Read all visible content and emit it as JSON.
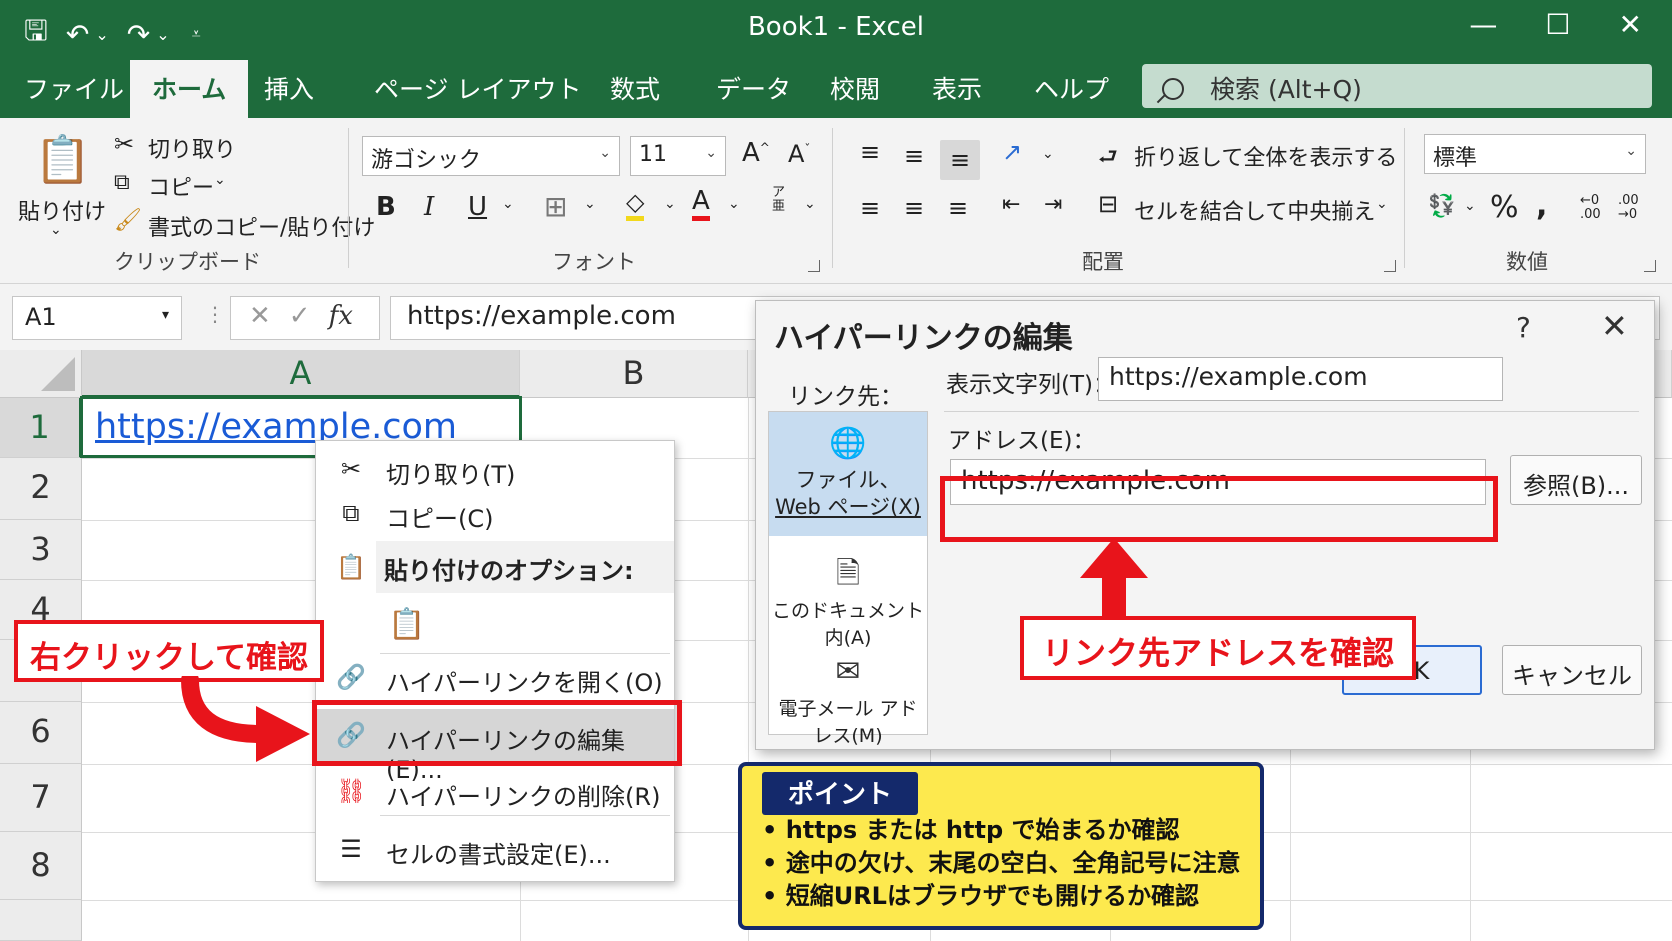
{
  "window": {
    "title": "Book1  -  Excel"
  },
  "tabs": [
    "ファイル",
    "ホーム",
    "挿入",
    "ページ レイアウト",
    "数式",
    "データ",
    "校閲",
    "表示",
    "ヘルプ"
  ],
  "search": {
    "placeholder": "検索 (Alt+Q)"
  },
  "clipboard": {
    "paste": "貼り付け",
    "cut": "切り取り",
    "copy": "コピー",
    "format_painter": "書式のコピー/貼り付け",
    "label": "クリップボード"
  },
  "font": {
    "name": "游ゴシック",
    "size": "11",
    "label": "フォント"
  },
  "alignment": {
    "wrap": "折り返して全体を表示する",
    "merge": "セルを結合して中央揃え",
    "label": "配置"
  },
  "number": {
    "format": "標準",
    "label": "数値"
  },
  "formula_bar": {
    "name_box": "A1",
    "formula": "https://example.com"
  },
  "grid": {
    "columns": [
      "A",
      "B"
    ],
    "rows": [
      "1",
      "2",
      "3",
      "4",
      "6",
      "7",
      "8"
    ],
    "a1_value": "https://example.com"
  },
  "context_menu": {
    "cut": "切り取り(T)",
    "copy": "コピー(C)",
    "paste_options": "貼り付けのオプション:",
    "open_link": "ハイパーリンクを開く(O)",
    "edit_link": "ハイパーリンクの編集(E)...",
    "remove_link": "ハイパーリンクの削除(R)",
    "format_cells": "セルの書式設定(E)..."
  },
  "dialog": {
    "title": "ハイパーリンクの編集",
    "link_to": "リンク先：",
    "nav": {
      "file_web_1": "ファイル、",
      "file_web_2": "Web ページ(X)",
      "this_doc": "このドキュメント内(A)",
      "email": "電子メール アドレス(M)"
    },
    "display_label": "表示文字列(T)：",
    "display_value": "https://example.com",
    "address_label": "アドレス(E)：",
    "address_value": "https://example.com",
    "browse": "参照(B)...",
    "ok": "OK",
    "cancel": "キャンセル"
  },
  "callouts": {
    "right_click": "右クリックして確認",
    "check_address": "リンク先アドレスを確認"
  },
  "point": {
    "title": "ポイント",
    "items": [
      "https または http で始まるか確認",
      "途中の欠け、末尾の空白、全角記号に注意",
      "短縮URLはブラウザでも開けるか確認"
    ]
  },
  "colors": {
    "excel_green": "#1e6b3c",
    "callout_red": "#e8141b",
    "point_yellow": "#fde94e",
    "point_navy": "#14296b",
    "link_blue": "#1a5bd6"
  }
}
